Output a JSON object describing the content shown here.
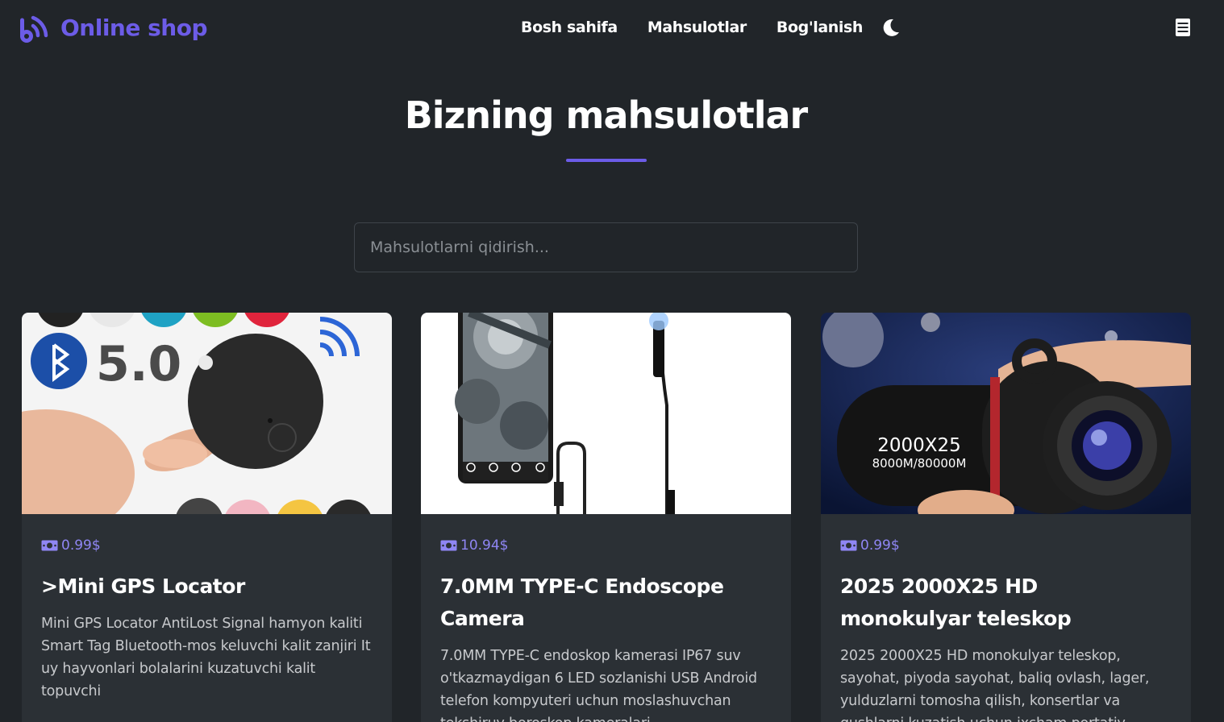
{
  "header": {
    "brand": "Online shop",
    "nav": [
      "Bosh sahifa",
      "Mahsulotlar",
      "Bog'lanish"
    ]
  },
  "main": {
    "title": "Bizning mahsulotlar",
    "search_placeholder": "Mahsulotlarni qidirish..."
  },
  "products": [
    {
      "price": "0.99$",
      "title": ">Mini GPS Locator",
      "description": "Mini GPS Locator AntiLost Signal hamyon kaliti Smart Tag Bluetooth-mos keluvchi kalit zanjiri It uy hayvonlari bolalarini kuzatuvchi kalit topuvchi",
      "image_text": "5.0"
    },
    {
      "price": "10.94$",
      "title": "7.0MM TYPE-C Endoscope Camera",
      "description": "7.0MM TYPE-C endoskop kamerasi IP67 suv o'tkazmaydigan 6 LED sozlanishi USB Android telefon kompyuteri uchun moslashuvchan tekshiruv boroskop kameralari"
    },
    {
      "price": "0.99$",
      "title": "2025 2000X25 HD monokulyar teleskop",
      "description": "2025 2000X25 HD monokulyar teleskop, sayohat, piyoda sayohat, baliq ovlash, lager, yulduzlarni tomosha qilish, konsertlar va qushlarni kuzatish uchun ixcham portativ",
      "image_text_1": "2000X25",
      "image_text_2": "8000M/80000M"
    }
  ],
  "colors": {
    "background": "#212529",
    "card": "#2b3035",
    "accent": "#6c5ce7",
    "price": "#8f86f4"
  },
  "icons": [
    "signal-logo-icon",
    "moon-icon",
    "menu-icon",
    "money-icon"
  ]
}
